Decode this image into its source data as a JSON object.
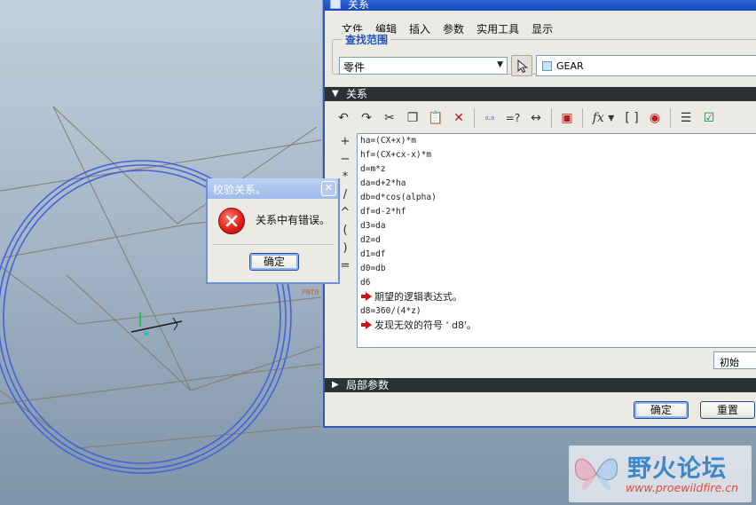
{
  "viewport": {
    "datum_label": "PNT0"
  },
  "relations_window": {
    "title": "关系",
    "menu": [
      "文件",
      "编辑",
      "插入",
      "参数",
      "实用工具",
      "显示"
    ],
    "scope": {
      "legend": "查找范围",
      "type_value": "零件",
      "model_value": "GEAR"
    },
    "relations_section": {
      "label": "关系"
    },
    "toolbar_icons": [
      "undo-icon",
      "redo-icon",
      "cut-icon",
      "copy-icon",
      "paste-icon",
      "delete-icon",
      "switch-symbols-icon",
      "evaluate-icon",
      "measure-icon",
      "units-icon",
      "function-icon",
      "brackets-icon",
      "verify-icon",
      "sort-icon",
      "check-icon"
    ],
    "side_symbols": [
      "+",
      "−",
      "*",
      "/",
      "^",
      "(",
      ")",
      "="
    ],
    "editor_lines": [
      {
        "text": "ha=(CX+x)*m",
        "error": false
      },
      {
        "text": "hf=(CX+cx-x)*m",
        "error": false
      },
      {
        "text": "d=m*z",
        "error": false
      },
      {
        "text": "da=d+2*ha",
        "error": false
      },
      {
        "text": "db=d*cos(alpha)",
        "error": false
      },
      {
        "text": "df=d-2*hf",
        "error": false
      },
      {
        "text": "d3=da",
        "error": false
      },
      {
        "text": "d2=d",
        "error": false
      },
      {
        "text": "d1=df",
        "error": false
      },
      {
        "text": "d0=db",
        "error": false
      },
      {
        "text": "d6",
        "error": false
      },
      {
        "text": "期望的逻辑表达式。",
        "error": true
      },
      {
        "text": "d8=360/(4*z)",
        "error": false
      },
      {
        "text": "发现无效的符号 ' d8'。",
        "error": true
      }
    ],
    "init_value": "初始",
    "local_params_label": "局部参数",
    "ok_label": "确定",
    "reset_label": "重置",
    "colors": {
      "title_blue": "#2459d0",
      "section_dark": "#2c3136",
      "error_red": "#c4161c"
    }
  },
  "message_box": {
    "title": "校验关系。",
    "message": "关系中有错误。",
    "ok_label": "确定"
  },
  "watermark": {
    "title": "野火论坛",
    "url": "www.proewildfire.cn"
  }
}
